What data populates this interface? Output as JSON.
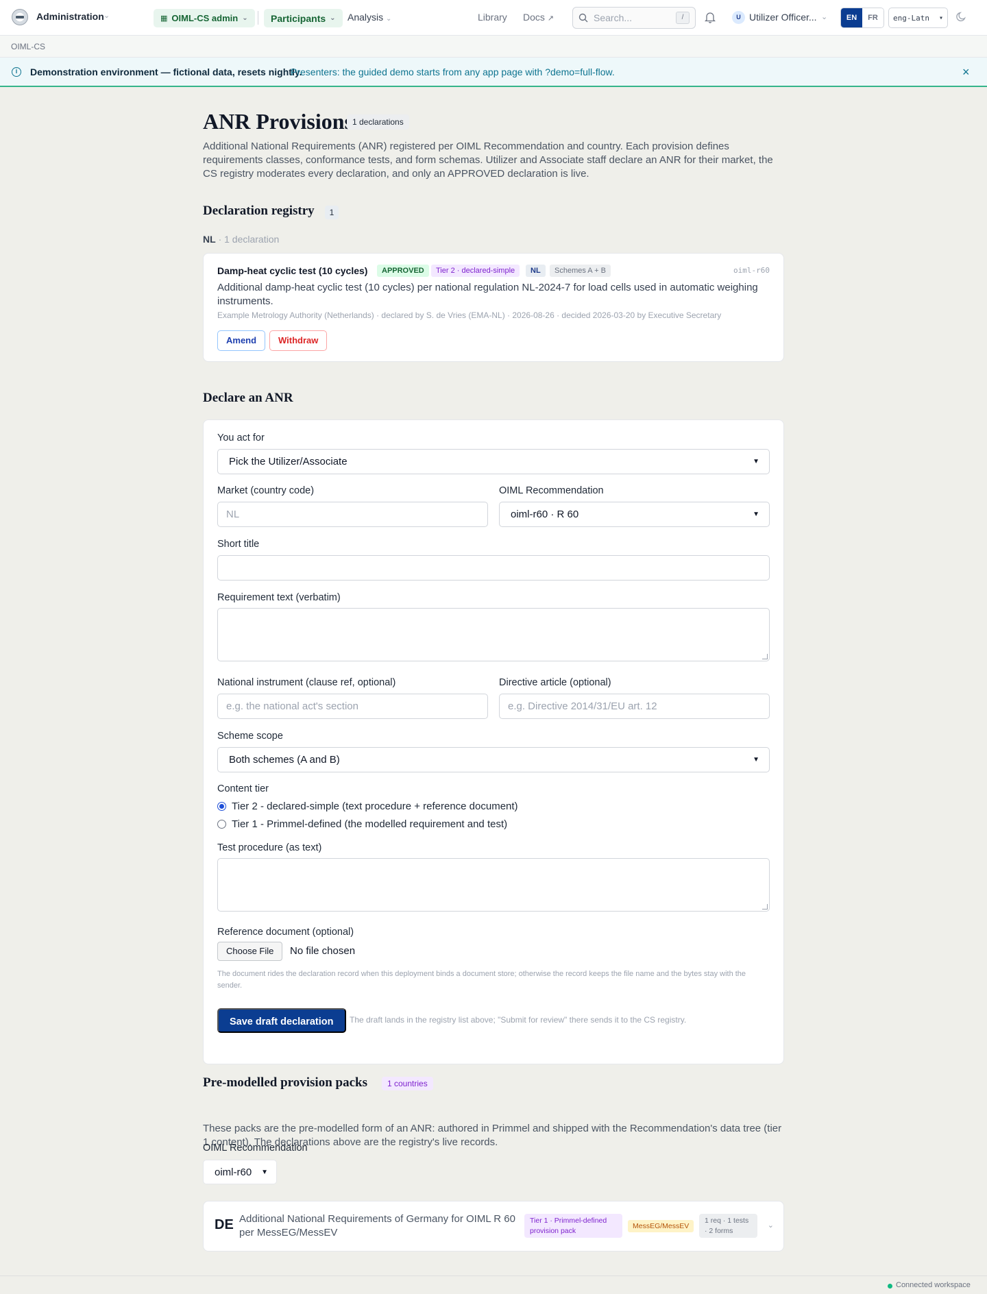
{
  "topbar": {
    "app_title": "Administration",
    "role_pill": "OIML-CS admin",
    "nav_participants": "Participants",
    "nav_analysis": "Analysis",
    "nav_library": "Library",
    "nav_docs": "Docs",
    "search_placeholder": "Search...",
    "search_shortcut": "/",
    "avatar_initial": "U",
    "user_name": "Utilizer Officer...",
    "lang_en": "EN",
    "lang_fr": "FR",
    "script_value": "eng-Latn"
  },
  "breadcrumb": "OIML-CS",
  "banner": {
    "strong": "Demonstration environment — fictional data, resets nightly.",
    "text": "Presenters: the guided demo starts from any app page with ?demo=full-flow."
  },
  "page": {
    "title": "ANR Provisions",
    "count_badge": "1 declarations",
    "intro": "Additional National Requirements (ANR) registered per OIML Recommendation and country. Each provision defines requirements classes, conformance tests, and form schemas. Utilizer and Associate staff declare an ANR for their market, the CS registry moderates every declaration, and only an APPROVED declaration is live."
  },
  "registry": {
    "title": "Declaration registry",
    "count": "1",
    "group_country": "NL",
    "group_suffix": "· 1 declaration",
    "declaration": {
      "title": "Damp-heat cyclic test (10 cycles)",
      "status": "APPROVED",
      "tier": "Tier 2 · declared-simple",
      "country": "NL",
      "schemes": "Schemes A + B",
      "code": "oiml-r60",
      "description": "Additional damp-heat cyclic test (10 cycles) per national regulation NL-2024-7 for load cells used in automatic weighing instruments.",
      "meta": "Example Metrology Authority (Netherlands) · declared by S. de Vries (EMA-NL) · 2026-08-26 · decided 2026-03-20 by Executive Secretary",
      "amend_label": "Amend",
      "withdraw_label": "Withdraw"
    }
  },
  "declare": {
    "title": "Declare an ANR",
    "act_for_label": "You act for",
    "act_for_value": "Pick the Utilizer/Associate",
    "market_label": "Market (country code)",
    "market_placeholder": "NL",
    "recommendation_label": "OIML Recommendation",
    "recommendation_value": "oiml-r60 · R 60",
    "short_title_label": "Short title",
    "requirement_label": "Requirement text (verbatim)",
    "instrument_label": "National instrument (clause ref, optional)",
    "instrument_placeholder": "e.g. the national act's section",
    "directive_label": "Directive article (optional)",
    "directive_placeholder": "e.g. Directive 2014/31/EU art. 12",
    "scheme_label": "Scheme scope",
    "scheme_value": "Both schemes (A and B)",
    "tier_label": "Content tier",
    "tier_options": [
      "Tier 2 - declared-simple (text procedure + reference document)",
      "Tier 1 - Primmel-defined (the modelled requirement and test)"
    ],
    "tier_selected": 0,
    "procedure_label": "Test procedure (as text)",
    "reference_label": "Reference document (optional)",
    "choose_file": "Choose File",
    "no_file": "No file chosen",
    "reference_help": "The document rides the declaration record when this deployment binds a document store; otherwise the record keeps the file name and the bytes stay with the sender.",
    "save_label": "Save draft declaration",
    "save_help": "The draft lands in the registry list above; \"Submit for review\" there sends it to the CS registry."
  },
  "packs": {
    "title": "Pre-modelled provision packs",
    "countries_badge": "1 countries",
    "intro": "These packs are the pre-modelled form of an ANR: authored in Primmel and shipped with the Recommendation's data tree (tier 1 content). The declarations above are the registry's live records.",
    "recommendation_label": "OIML Recommendation",
    "recommendation_value": "oiml-r60",
    "item": {
      "country": "DE",
      "title": "Additional National Requirements of Germany for OIML R 60 per MessEG/MessEV",
      "tier": "Tier 1 · Primmel-defined provision pack",
      "law": "MessEG/MessEV",
      "stats": "1 req · 1 tests · 2 forms"
    }
  },
  "footer": {
    "status": "Connected workspace"
  },
  "colors": {
    "primary": "#0b3d91",
    "approved": "#166534",
    "accent_teal": "#0e7490",
    "banner_border": "#34b58a"
  }
}
